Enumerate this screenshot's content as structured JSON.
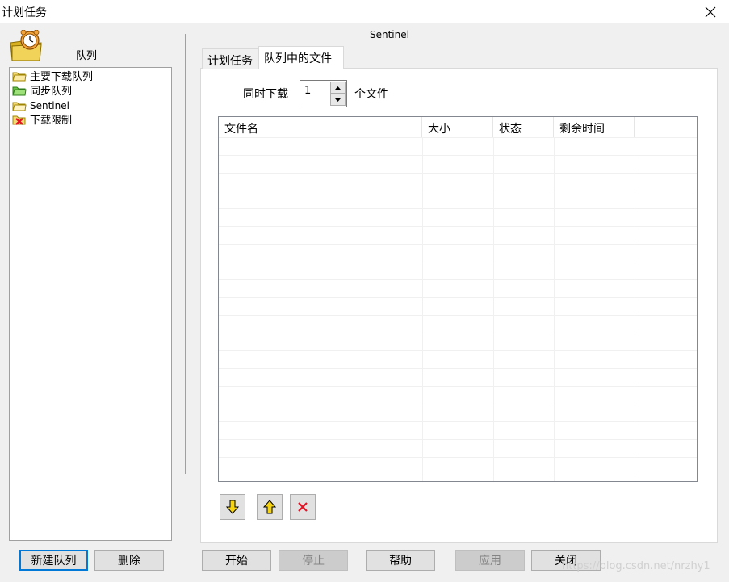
{
  "window": {
    "title": "计划任务",
    "close_icon": "close-icon"
  },
  "left": {
    "queue_label": "队列",
    "items": [
      {
        "label": "主要下载队列",
        "icon": "folder-yellow-icon"
      },
      {
        "label": "同步队列",
        "icon": "folder-green-icon"
      },
      {
        "label": "Sentinel",
        "icon": "folder-yellow-icon"
      },
      {
        "label": "下载限制",
        "icon": "folder-blocked-icon"
      }
    ],
    "buttons": {
      "new_queue": "新建队列",
      "delete": "删除"
    }
  },
  "main": {
    "header_title": "Sentinel",
    "tabs": [
      {
        "label": "计划任务",
        "active": false
      },
      {
        "label": "队列中的文件",
        "active": true
      }
    ],
    "concurrent": {
      "prefix": "同时下载",
      "value": "1",
      "suffix": "个文件"
    },
    "table": {
      "columns": [
        "文件名",
        "大小",
        "状态",
        "剩余时间"
      ],
      "rows": []
    },
    "toolbar": {
      "move_down_icon": "arrow-down-icon",
      "move_up_icon": "arrow-up-icon",
      "remove_icon": "delete-x-icon"
    }
  },
  "footer": {
    "start": "开始",
    "stop": "停止",
    "help": "帮助",
    "apply": "应用",
    "close": "关闭"
  },
  "watermark": "https://blog.csdn.net/nrzhy1",
  "colors": {
    "accent": "#0078d7",
    "disabled_text": "#838383",
    "error_red": "#e81123",
    "arrow_yellow": "#f5d30f"
  }
}
